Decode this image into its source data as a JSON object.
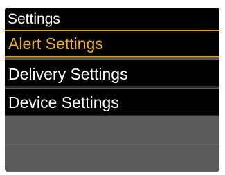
{
  "header": {
    "title": "Settings"
  },
  "menu": {
    "items": [
      {
        "label": "Alert Settings",
        "selected": true
      },
      {
        "label": "Delivery Settings",
        "selected": false
      },
      {
        "label": "Device Settings",
        "selected": false
      }
    ]
  },
  "colors": {
    "background": "#000000",
    "text": "#ffffff",
    "selected_text": "#f2b21b",
    "selected_border": "#d9a21a",
    "empty_area": "#5b5b5b"
  }
}
